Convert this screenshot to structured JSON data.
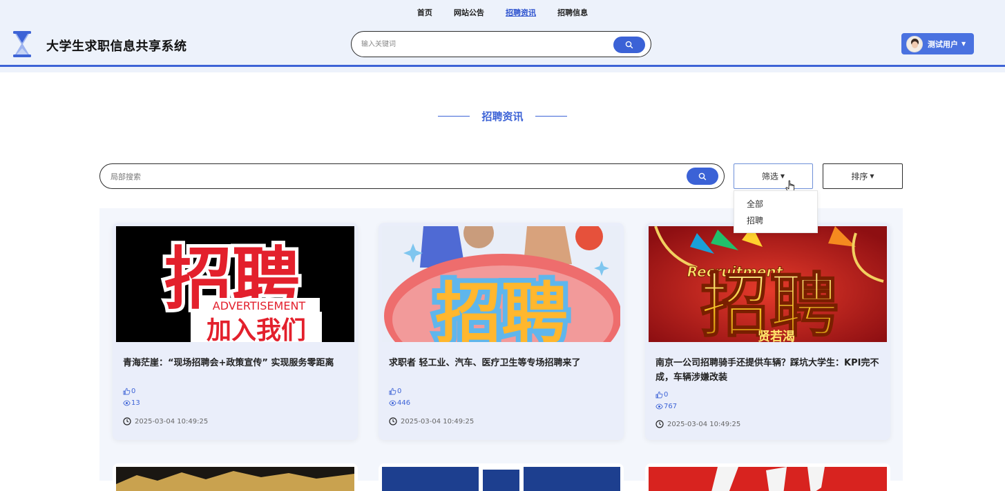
{
  "nav": {
    "items": [
      {
        "label": "首页",
        "active": false
      },
      {
        "label": "网站公告",
        "active": false
      },
      {
        "label": "招聘资讯",
        "active": true
      },
      {
        "label": "招聘信息",
        "active": false
      }
    ]
  },
  "header": {
    "title": "大学生求职信息共享系统",
    "search_placeholder": "输入关键词"
  },
  "user": {
    "name": "测试用户"
  },
  "section": {
    "title": "招聘资讯"
  },
  "toolbar": {
    "search_placeholder": "局部搜索",
    "filter_label": "筛选",
    "sort_label": "排序"
  },
  "filter_dropdown": {
    "options": [
      "全部",
      "招聘"
    ]
  },
  "cards": [
    {
      "title": "青海茫崖：“现场招聘会+政策宣传” 实现服务零距离",
      "likes": "0",
      "views": "13",
      "time": "2025-03-04 10:49:25",
      "image_text": [
        "招聘",
        "ADVERTISEMENT",
        "加入我们"
      ]
    },
    {
      "title": "求职者 轻工业、汽车、医疗卫生等专场招聘来了",
      "likes": "0",
      "views": "446",
      "time": "2025-03-04 10:49:25",
      "image_text": [
        "招聘"
      ]
    },
    {
      "title": "南京一公司招聘骑手还提供车辆？踩坑大学生：KPI完不成，车辆涉嫌改装",
      "likes": "0",
      "views": "767",
      "time": "2025-03-04 10:49:25",
      "image_text": [
        "Recruitment",
        "招聘",
        "贤若渴"
      ]
    }
  ],
  "colors": {
    "accent": "#3d63d6",
    "header_bg": "#edf2fb",
    "card_bg": "#eaeefa"
  }
}
